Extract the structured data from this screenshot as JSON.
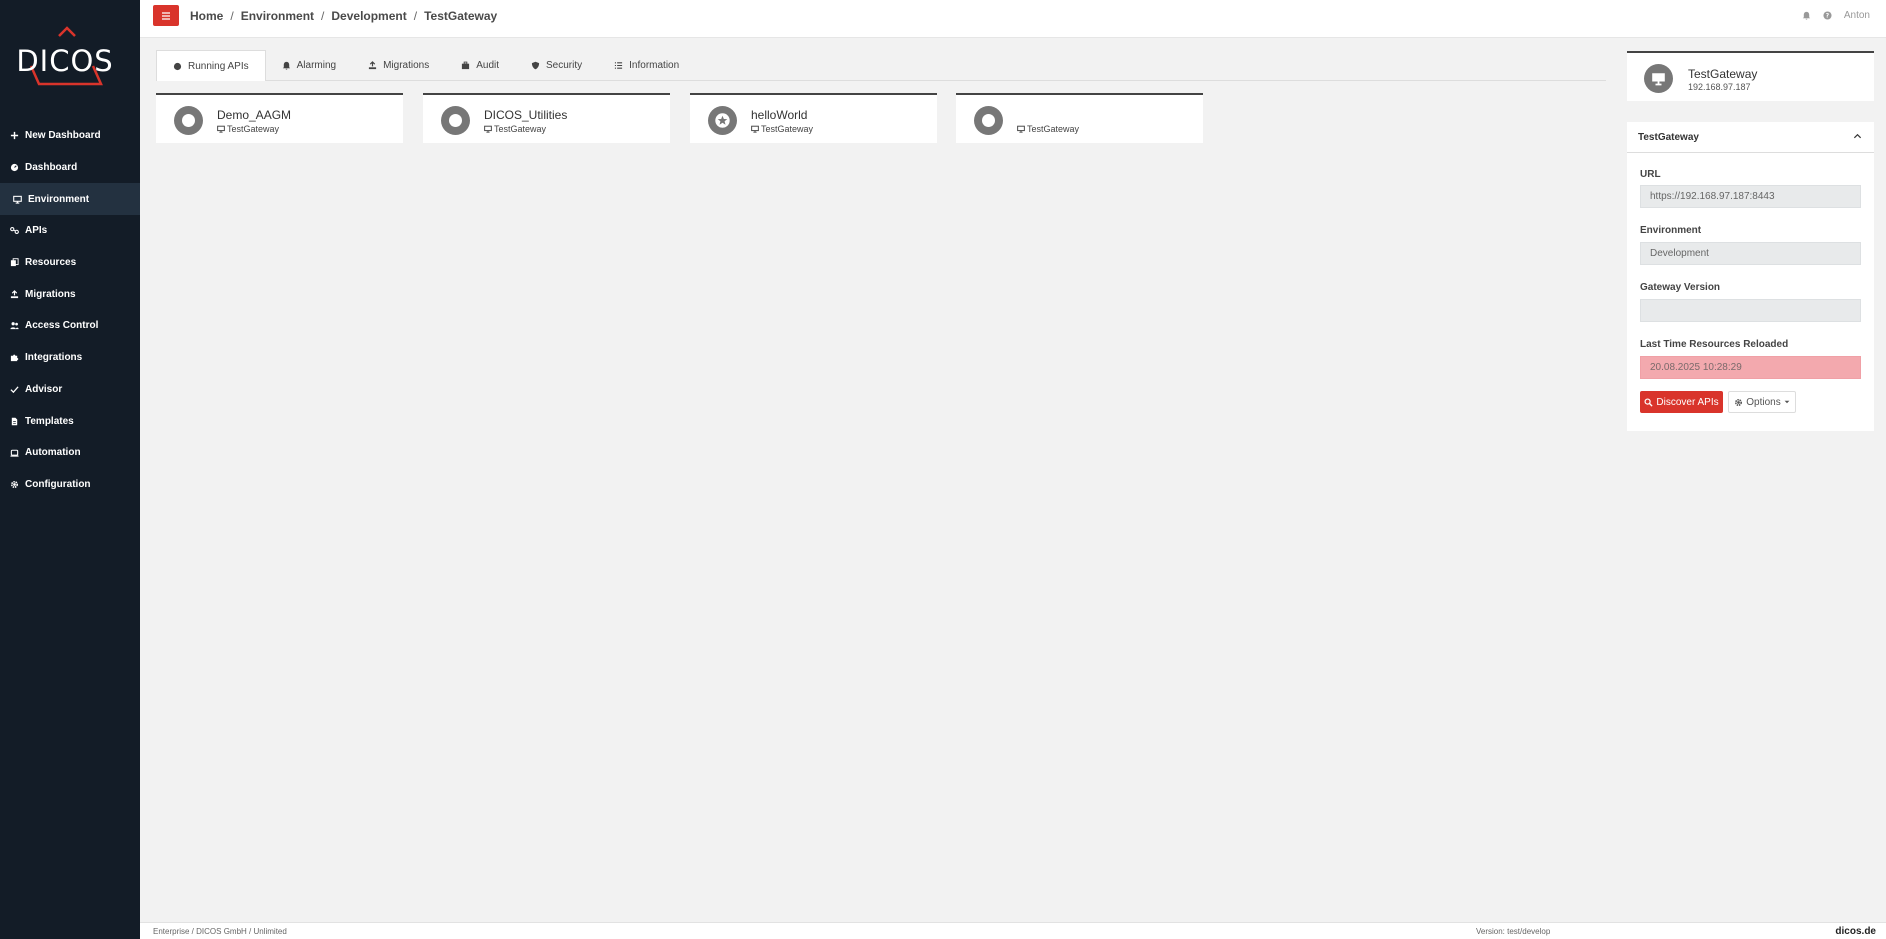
{
  "brand": {
    "logo_text": "DICOS",
    "accent_color": "#d9342b",
    "sidebar_color": "#131c27"
  },
  "sidebar": {
    "items": [
      {
        "label": "New Dashboard",
        "icon": "plus-icon"
      },
      {
        "label": "Dashboard",
        "icon": "gauge-icon"
      },
      {
        "label": "Environment",
        "icon": "monitor-icon",
        "active": true
      },
      {
        "label": "APIs",
        "icon": "link-icon"
      },
      {
        "label": "Resources",
        "icon": "copy-icon"
      },
      {
        "label": "Migrations",
        "icon": "upload-icon"
      },
      {
        "label": "Access Control",
        "icon": "users-icon"
      },
      {
        "label": "Integrations",
        "icon": "puzzle-icon"
      },
      {
        "label": "Advisor",
        "icon": "check-icon"
      },
      {
        "label": "Templates",
        "icon": "file-icon"
      },
      {
        "label": "Automation",
        "icon": "robot-icon"
      },
      {
        "label": "Configuration",
        "icon": "gear-icon"
      }
    ]
  },
  "header": {
    "breadcrumb": [
      "Home",
      "Environment",
      "Development",
      "TestGateway"
    ],
    "separator": "/",
    "user": "Anton"
  },
  "tabs": [
    {
      "label": "Running APIs",
      "icon": "circle-icon",
      "active": true
    },
    {
      "label": "Alarming",
      "icon": "bell-icon"
    },
    {
      "label": "Migrations",
      "icon": "upload-icon"
    },
    {
      "label": "Audit",
      "icon": "briefcase-icon"
    },
    {
      "label": "Security",
      "icon": "shield-icon"
    },
    {
      "label": "Information",
      "icon": "list-icon"
    }
  ],
  "apis": [
    {
      "name": "Demo_AAGM",
      "gateway": "TestGateway",
      "icon": "ring-icon"
    },
    {
      "name": "DICOS_Utilities",
      "gateway": "TestGateway",
      "icon": "ring-icon"
    },
    {
      "name": "helloWorld",
      "gateway": "TestGateway",
      "icon": "star-icon"
    },
    {
      "name": "",
      "gateway": "TestGateway",
      "icon": "ring-icon"
    }
  ],
  "gateway": {
    "name": "TestGateway",
    "ip": "192.168.97.187",
    "panel_title": "TestGateway",
    "url_label": "URL",
    "url_value": "https://192.168.97.187:8443",
    "env_label": "Environment",
    "env_value": "Development",
    "version_label": "Gateway Version",
    "version_value": "",
    "reload_label": "Last Time Resources Reloaded",
    "reload_value": "20.08.2025 10:28:29",
    "discover_label": "Discover APIs",
    "options_label": "Options"
  },
  "footer": {
    "license": "Enterprise / DICOS GmbH / Unlimited",
    "version": "Version: test/develop",
    "site": "dicos.de"
  }
}
